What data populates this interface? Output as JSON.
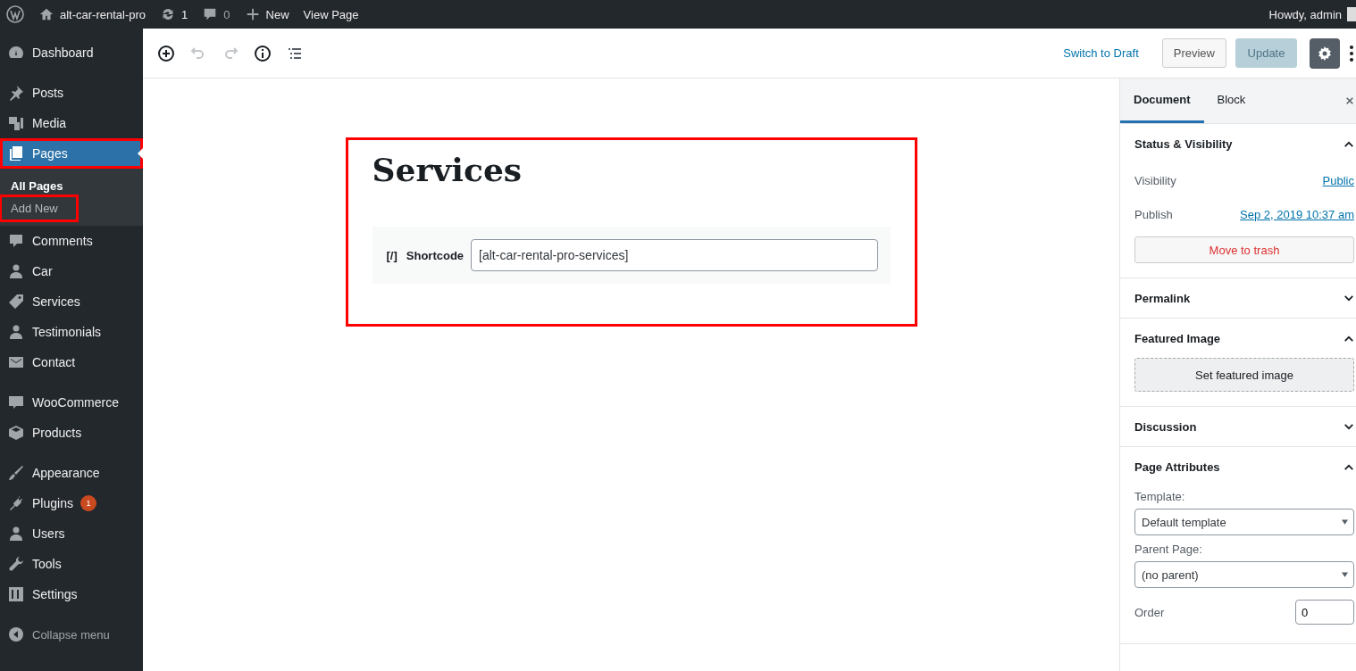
{
  "admin_bar": {
    "site": "alt-car-rental-pro",
    "updates": "1",
    "comments": "0",
    "new": "New",
    "view": "View Page",
    "greeting": "Howdy, admin"
  },
  "sidebar": {
    "groups": [
      [
        {
          "label": "Dashboard",
          "selected": false,
          "highlighted": false
        }
      ],
      [
        {
          "label": "Posts",
          "selected": false,
          "highlighted": false
        },
        {
          "label": "Media",
          "selected": false,
          "highlighted": false
        },
        {
          "label": "Pages",
          "selected": true,
          "highlighted": true,
          "children": [
            {
              "label": "All Pages",
              "selected": true,
              "highlighted": false
            },
            {
              "label": "Add New",
              "selected": false,
              "highlighted": true
            }
          ]
        },
        {
          "label": "Comments",
          "selected": false,
          "highlighted": false
        },
        {
          "label": "Car",
          "selected": false,
          "highlighted": false
        },
        {
          "label": "Services",
          "selected": false,
          "highlighted": false
        },
        {
          "label": "Testimonials",
          "selected": false,
          "highlighted": false
        },
        {
          "label": "Contact",
          "selected": false,
          "highlighted": false
        }
      ],
      [
        {
          "label": "WooCommerce",
          "selected": false,
          "highlighted": false
        },
        {
          "label": "Products",
          "selected": false,
          "highlighted": false
        }
      ],
      [
        {
          "label": "Appearance",
          "selected": false,
          "highlighted": false
        },
        {
          "label": "Plugins",
          "selected": false,
          "highlighted": false,
          "badge": "1"
        },
        {
          "label": "Users",
          "selected": false,
          "highlighted": false
        },
        {
          "label": "Tools",
          "selected": false,
          "highlighted": false
        },
        {
          "label": "Settings",
          "selected": false,
          "highlighted": false
        }
      ]
    ],
    "collapse": "Collapse menu"
  },
  "toolbar": {
    "switch_to_draft": "Switch to Draft",
    "preview": "Preview",
    "update": {
      "label": "Update",
      "disabled": true
    },
    "settings_selected": true
  },
  "editor": {
    "highlighted": true,
    "title": "Services",
    "block": {
      "icon_text": "[/]",
      "label": "Shortcode",
      "value": "[alt-car-rental-pro-services]"
    }
  },
  "settings_panel": {
    "tabs": [
      {
        "label": "Document",
        "selected": true
      },
      {
        "label": "Block",
        "selected": false
      }
    ],
    "sections": [
      {
        "kind": "status",
        "title": "Status & Visibility",
        "expanded": true,
        "rows": [
          {
            "label": "Visibility",
            "value": "Public"
          },
          {
            "label": "Publish",
            "value": "Sep 2, 2019 10:37 am"
          }
        ],
        "action": "Move to trash"
      },
      {
        "kind": "plain",
        "title": "Permalink",
        "expanded": false
      },
      {
        "kind": "featured",
        "title": "Featured Image",
        "expanded": true,
        "action": "Set featured image"
      },
      {
        "kind": "plain",
        "title": "Discussion",
        "expanded": false
      },
      {
        "kind": "attributes",
        "title": "Page Attributes",
        "expanded": true,
        "template_label": "Template:",
        "template": "Default template",
        "parent_label": "Parent Page:",
        "parent": "(no parent)",
        "order_label": "Order",
        "order": "0"
      }
    ]
  }
}
